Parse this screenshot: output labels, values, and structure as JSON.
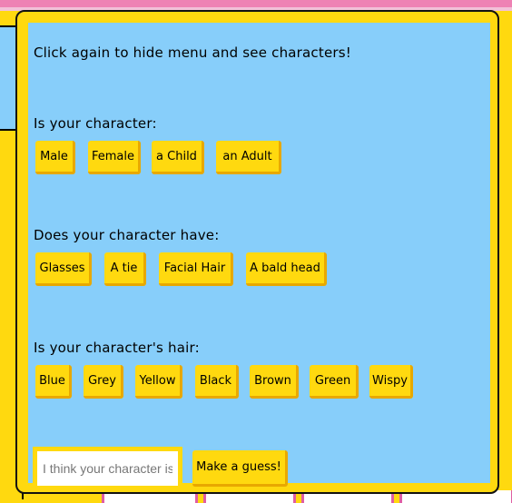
{
  "menu": {
    "hint": "Click again to hide menu and see characters!",
    "q1": {
      "label": "Is your character:",
      "options": [
        "Male",
        "Female",
        "a Child",
        "an Adult"
      ]
    },
    "q2": {
      "label": "Does your character have:",
      "options": [
        "Glasses",
        "A tie",
        "Facial Hair",
        "A bald head"
      ]
    },
    "q3": {
      "label": "Is your character's hair:",
      "options": [
        "Blue",
        "Grey",
        "Yellow",
        "Black",
        "Brown",
        "Green",
        "Wispy"
      ]
    },
    "guess": {
      "placeholder": "I think your character is...",
      "button": "Make a guess!"
    }
  },
  "colors": {
    "background": "#ffd90f",
    "panel_inner": "#87cefa",
    "button": "#ffd90f",
    "button_shadow": "#e8a800",
    "accent_pink": "#ee82b4"
  }
}
